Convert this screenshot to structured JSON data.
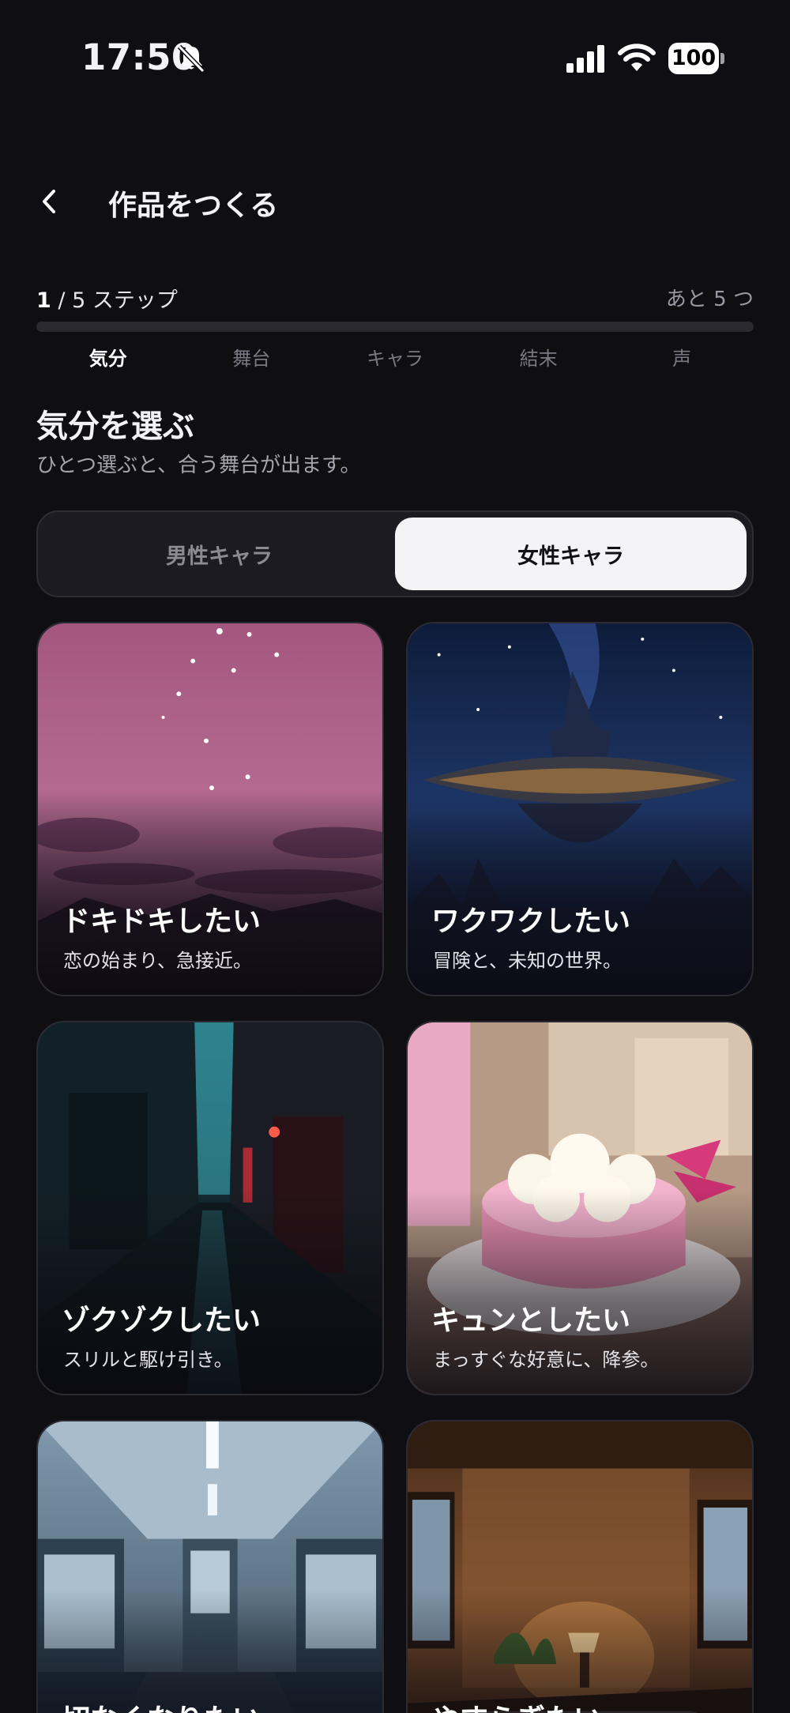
{
  "status_bar": {
    "time": "17:50",
    "battery": "100",
    "icons": [
      "bell-slash-icon",
      "cellular-signal-icon",
      "wifi-icon",
      "battery-icon"
    ]
  },
  "header": {
    "title": "作品をつくる",
    "back_icon": "chevron-left-icon"
  },
  "progress": {
    "current": "1",
    "separator": "/",
    "total_text": "5 ステップ",
    "remaining": "あと 5 つ",
    "fraction": 0,
    "steps": [
      "気分",
      "舞台",
      "キャラ",
      "結末",
      "声"
    ],
    "active_step": 0
  },
  "section": {
    "title": "気分を選ぶ",
    "subtitle": "ひとつ選ぶと、合う舞台が出ます。"
  },
  "toggle": {
    "options": [
      "男性キャラ",
      "女性キャラ"
    ],
    "selected": 1
  },
  "cards": [
    {
      "title": "ドキドキしたい",
      "desc": "恋の始まり、急接近。",
      "scene": "pink-dusk-sky"
    },
    {
      "title": "ワクワクしたい",
      "desc": "冒険と、未知の世界。",
      "scene": "floating-island-starry-sky"
    },
    {
      "title": "ゾクゾクしたい",
      "desc": "スリルと駆け引き。",
      "scene": "dark-rainy-alley"
    },
    {
      "title": "キュンとしたい",
      "desc": "まっすぐな好意に、降参。",
      "scene": "pink-cream-cake"
    },
    {
      "title": "切なくなりたい",
      "desc": "",
      "scene": "empty-train-interior"
    },
    {
      "title": "やすらぎたい",
      "desc": "",
      "scene": "cozy-wooden-cabin"
    }
  ],
  "colors": {
    "background": "#0f0e13",
    "selected_segment": "#f4f4f6",
    "card_border": "#2c2b33"
  }
}
